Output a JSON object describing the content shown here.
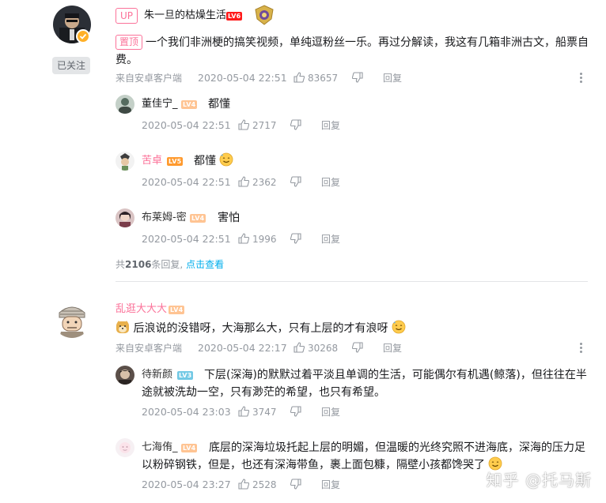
{
  "comment1": {
    "up_tag": "UP",
    "user": "朱一旦的枯燥生活",
    "level": "LV6",
    "follow_label": "已关注",
    "pin_tag": "置顶",
    "text": "一个我们非洲梗的搞笑视频，单纯逗粉丝一乐。再过分解读，我这有几箱非洲古文，船票自费。",
    "source": "来自安卓客户端",
    "date": "2020-05-04 22:51",
    "likes": "83657",
    "reply_label": "回复",
    "replies": [
      {
        "user": "董佳宁_",
        "level": "LV4",
        "text": "都懂",
        "date": "2020-05-04 22:51",
        "likes": "2717",
        "reply_label": "回复"
      },
      {
        "user": "苦卓",
        "level": "LV5",
        "text": "都懂",
        "date": "2020-05-04 22:51",
        "likes": "2362",
        "reply_label": "回复"
      },
      {
        "user": "布莱姆-密",
        "level": "LV4",
        "text": "害怕",
        "date": "2020-05-04 22:51",
        "likes": "1996",
        "reply_label": "回复"
      }
    ],
    "more_prefix": "共",
    "more_count": "2106",
    "more_suffix": "条回复, ",
    "more_link": "点击查看"
  },
  "comment2": {
    "user": "乱逛大大大",
    "level": "LV4",
    "text": "后浪说的没错呀，大海那么大，只有上层的才有浪呀",
    "source": "来自安卓客户端",
    "date": "2020-05-04 22:17",
    "likes": "30268",
    "reply_label": "回复",
    "replies": [
      {
        "user": "待新颜",
        "level": "LV3",
        "text": "下层(深海)的默默过着平淡且单调的生活，可能偶尔有机遇(鲸落)，但往往在半途就被洗劫一空，只有渺茫的希望，也只有希望。",
        "date": "2020-05-04 23:03",
        "likes": "3747",
        "reply_label": "回复"
      },
      {
        "user": "七海侑_",
        "level": "LV4",
        "text": "底层的深海垃圾托起上层的明媚，但温暖的光终究照不进海底，深海的压力足以粉碎钢铁，但是，也还有深海带鱼，裹上面包糠，隔壁小孩都馋哭了",
        "date": "2020-05-04 23:27",
        "likes": "2528",
        "reply_label": "回复"
      }
    ]
  },
  "watermark": "知乎 @托马斯",
  "colors": {
    "pink": "#fb7299",
    "link": "#00aeec",
    "gray": "#9499a0"
  }
}
